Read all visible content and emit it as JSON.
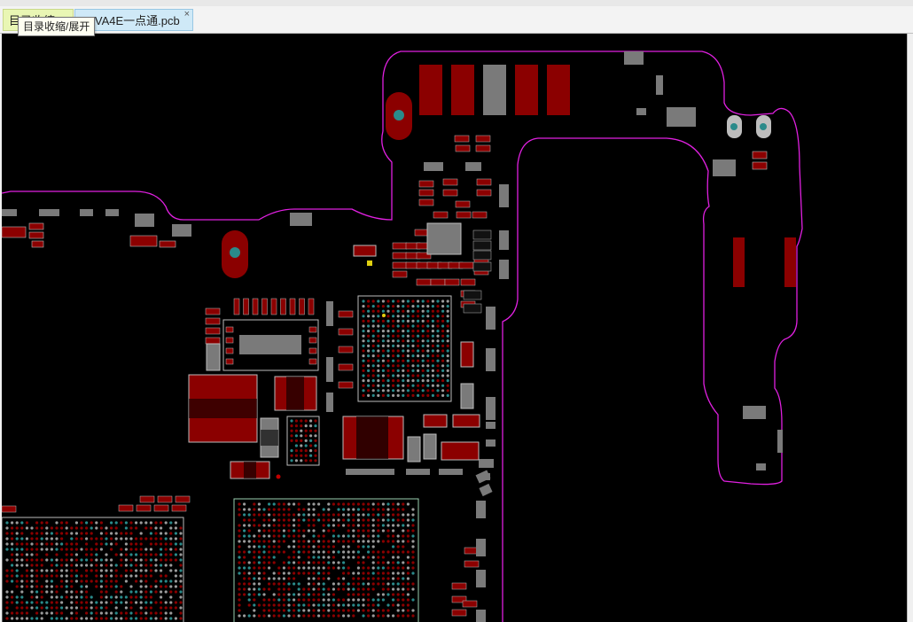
{
  "tabs": [
    {
      "label": "目录收缩",
      "active": false
    },
    {
      "label": "A2VA4E一点通.pcb",
      "active": true
    }
  ],
  "tab_close_glyph": "×",
  "tooltip": "目录收缩/展开",
  "board": {
    "outline_color": "#e020e0",
    "pad_red": "#8b0000",
    "pad_gray": "#7a7a7a",
    "teal": "#2a8a8a"
  }
}
